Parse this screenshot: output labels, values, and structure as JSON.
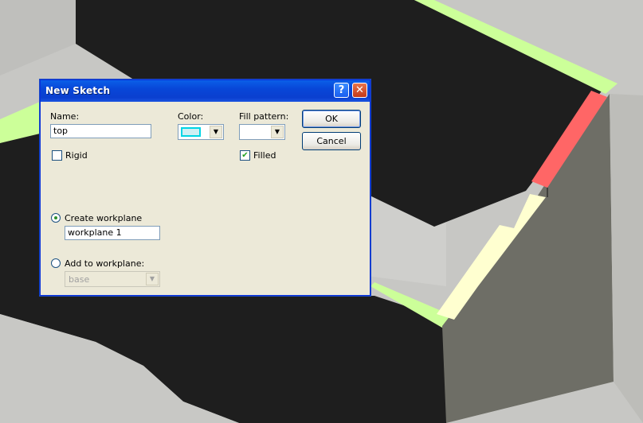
{
  "window": {
    "title": "New Sketch",
    "help_glyph": "?",
    "close_glyph": "✕"
  },
  "form": {
    "name_label": "Name:",
    "name_value": "top",
    "color_label": "Color:",
    "color_value": "#cfeff3",
    "fill_pattern_label": "Fill pattern:",
    "fill_pattern_value": "",
    "rigid_label": "Rigid",
    "rigid_checked": false,
    "filled_label": "Filled",
    "filled_checked": true,
    "create_workplane_label": "Create workplane",
    "create_workplane_selected": true,
    "workplane_name_value": "workplane 1",
    "add_to_workplane_label": "Add to workplane:",
    "add_to_workplane_selected": false,
    "add_to_workplane_value": "base"
  },
  "buttons": {
    "ok_label": "OK",
    "cancel_label": "Cancel"
  },
  "colors": {
    "title_bar": "#0a46d8",
    "dialog_face": "#ece9d8",
    "model_black": "#1e1e1e",
    "model_gray": "#6e6e66",
    "edge_green": "#ccff99",
    "highlight_red": "#ff6666",
    "highlight_yellow": "#ffffd0"
  }
}
